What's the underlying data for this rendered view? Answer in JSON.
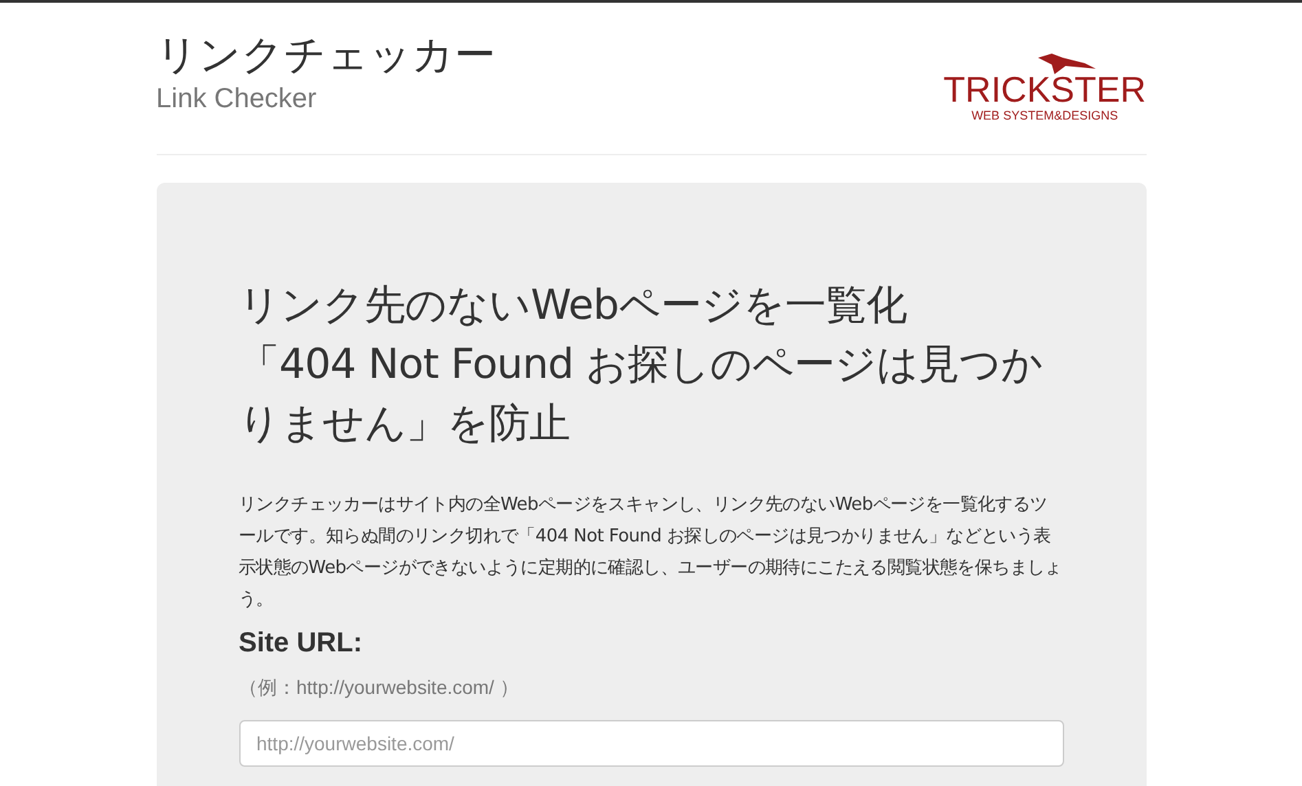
{
  "header": {
    "title": "リンクチェッカー",
    "subtitle": "Link Checker",
    "logo": {
      "name": "TRICKSTER",
      "tagline": "WEB SYSTEM&DESIGNS"
    }
  },
  "hero": {
    "heading_lines": [
      "リンク先のないWebページを一覧化",
      "「404 Not Found お探しのページは見つかりません」を防止"
    ],
    "description": "リンクチェッカーはサイト内の全Webページをスキャンし、リンク先のないWebページを一覧化するツールです。知らぬ間のリンク切れで「404 Not Found お探しのページは見つかりません」などという表示状態のWebページができないように定期的に確認し、ユーザーの期待にこたえる閲覧状態を保ちましょう。",
    "form": {
      "label": "Site URL:",
      "example": "（例：http://yourwebsite.com/ ）",
      "placeholder": "http://yourwebsite.com/"
    }
  }
}
